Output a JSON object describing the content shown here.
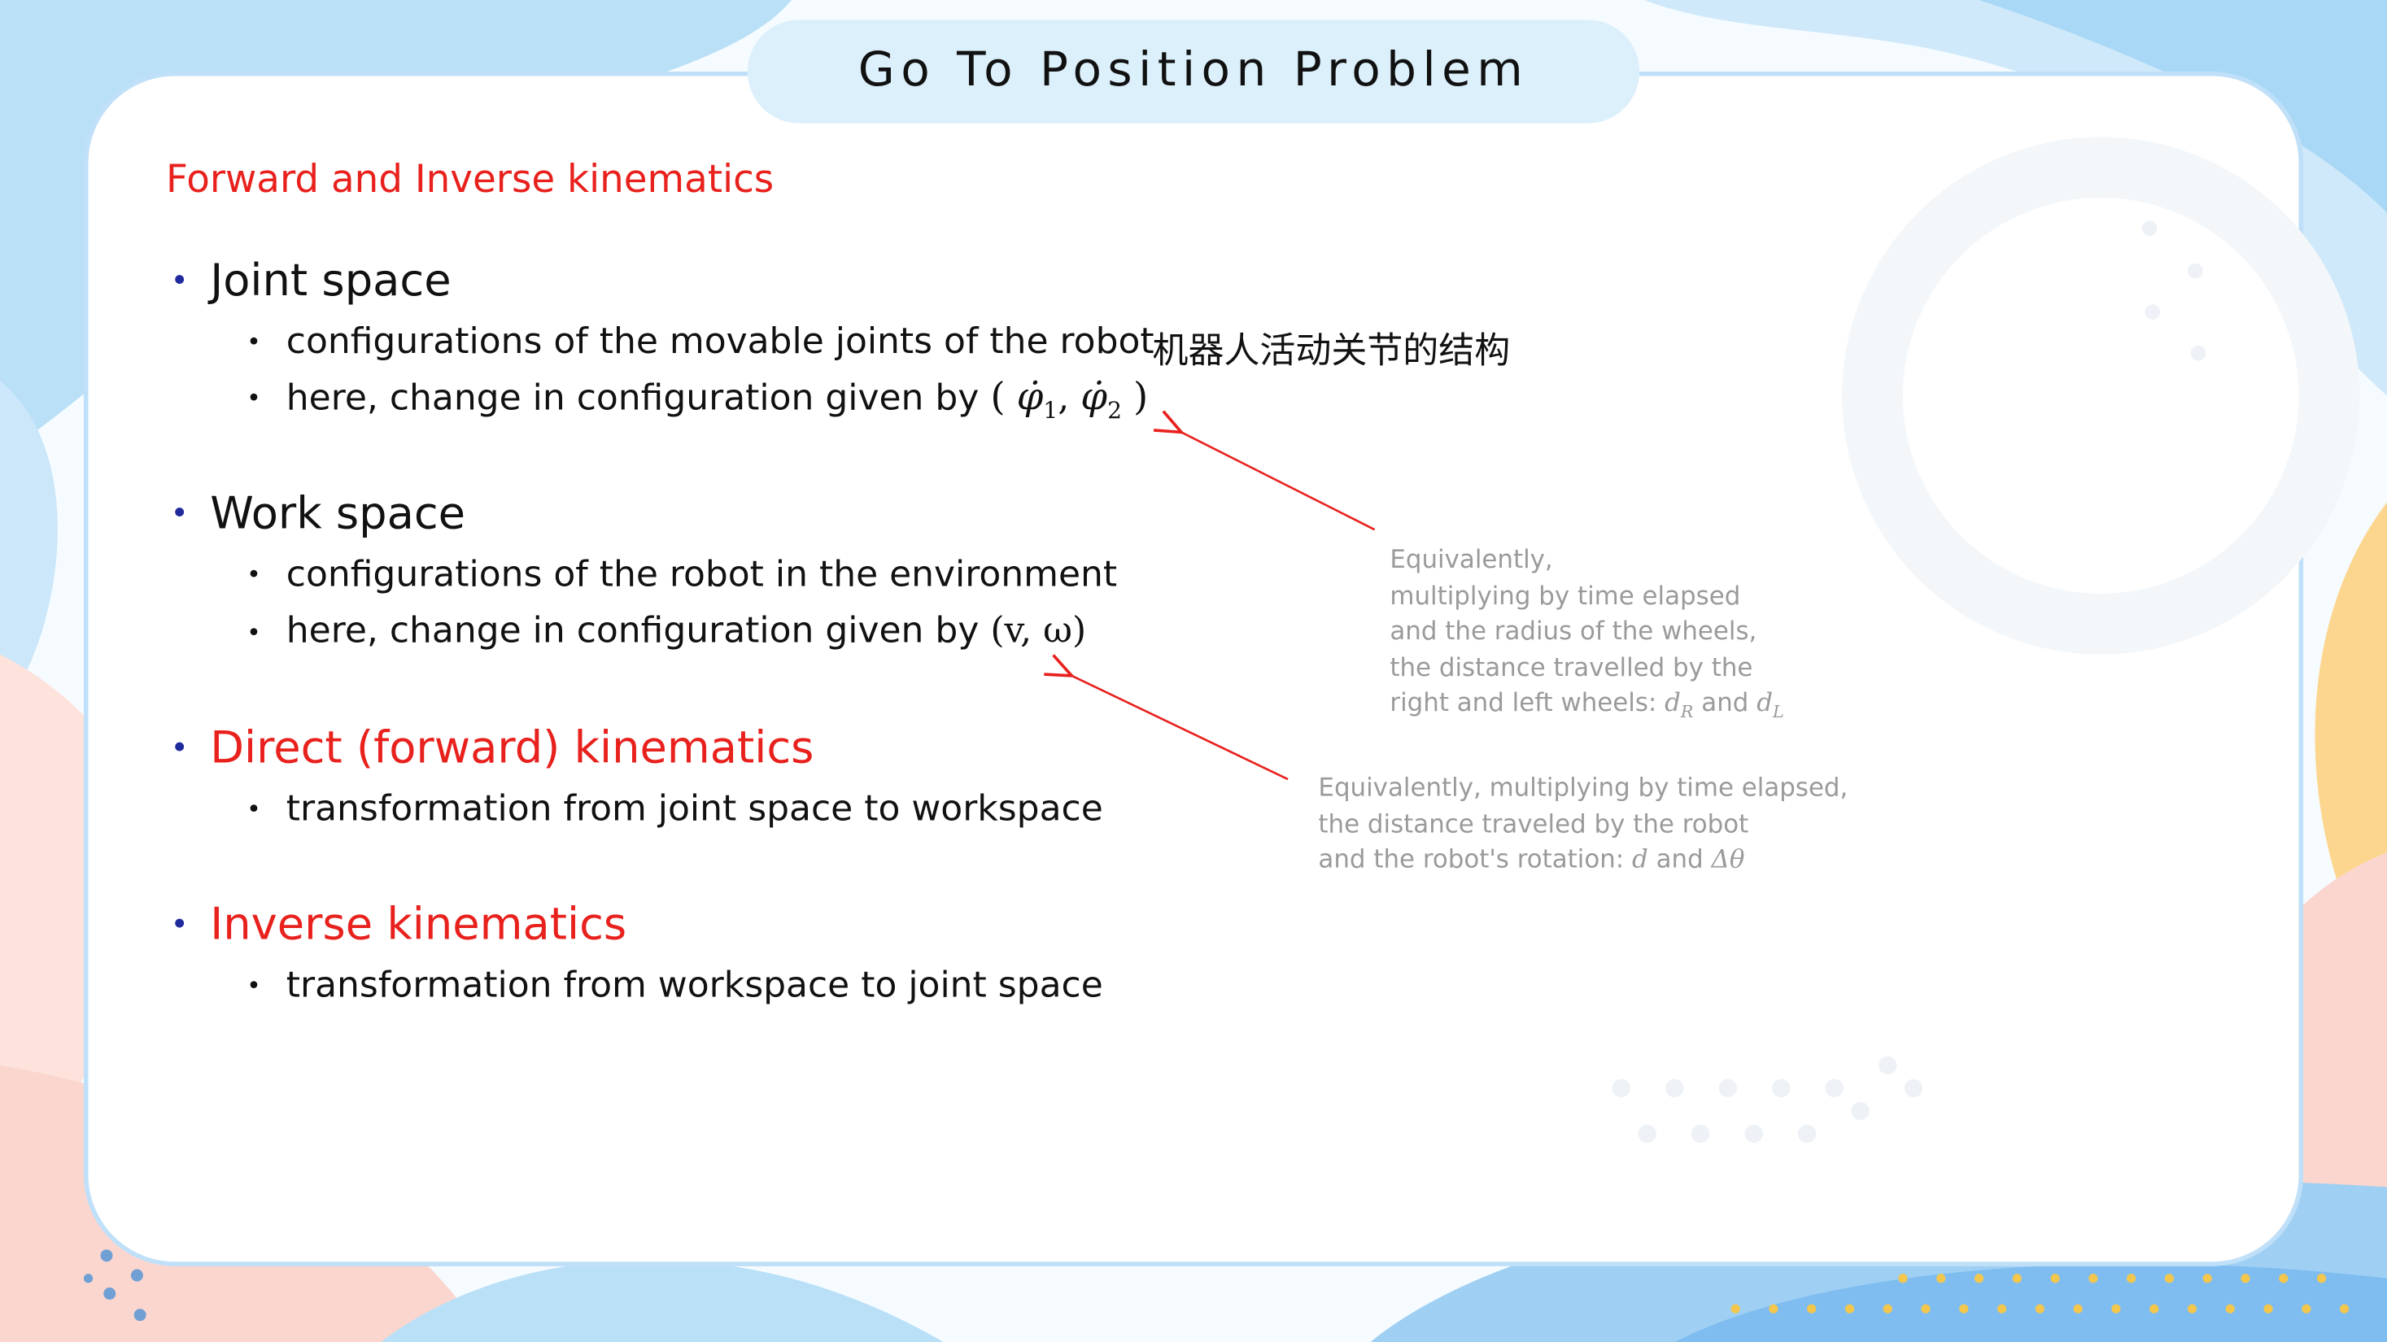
{
  "slide": {
    "title": "Go To Position Problem",
    "subtitle": "Forward and Inverse kinematics"
  },
  "sections": {
    "joint_space": {
      "heading": "Joint space",
      "bullet1": "configurations of the movable joints of the robot",
      "bullet2_text": "here, change in configuration given by",
      "bullet2_math_open": "(",
      "bullet2_math_phi1": "φ̇",
      "bullet2_math_sub1": "1",
      "bullet2_math_sep": ",",
      "bullet2_math_phi2": "φ̇",
      "bullet2_math_sub2": "2",
      "bullet2_math_close": ")",
      "chinese_note": "机器人活动关节的结构"
    },
    "work_space": {
      "heading": "Work space",
      "bullet1": "configurations of the robot in the environment",
      "bullet2_text": "here, change in configuration given by",
      "bullet2_math": "(v, ω)"
    },
    "direct": {
      "heading": "Direct (forward) kinematics",
      "bullet1": "transformation from joint space to workspace"
    },
    "inverse": {
      "heading": "Inverse kinematics",
      "bullet1": "transformation from workspace to joint space"
    }
  },
  "notes": {
    "wheels": {
      "line1": "Equivalently,",
      "line2": "multiplying by time elapsed",
      "line3": "and the radius of the wheels,",
      "line4": "the distance travelled by the",
      "line5_text": "right and left wheels:",
      "line5_dR": "d",
      "line5_dR_sub": "R",
      "line5_and": "and",
      "line5_dL": "d",
      "line5_dL_sub": "L"
    },
    "robot": {
      "line1": "Equivalently, multiplying by time elapsed,",
      "line2": "the distance traveled by the robot",
      "line3_text": "and the robot's rotation:",
      "line3_d": "d",
      "line3_and": "and",
      "line3_delta": "Δθ"
    }
  },
  "colors": {
    "accent_red": "#e8211d",
    "bullet_blue": "#1f2a9c",
    "note_gray": "#9a9a9a",
    "arrow_red": "#e8211d"
  }
}
